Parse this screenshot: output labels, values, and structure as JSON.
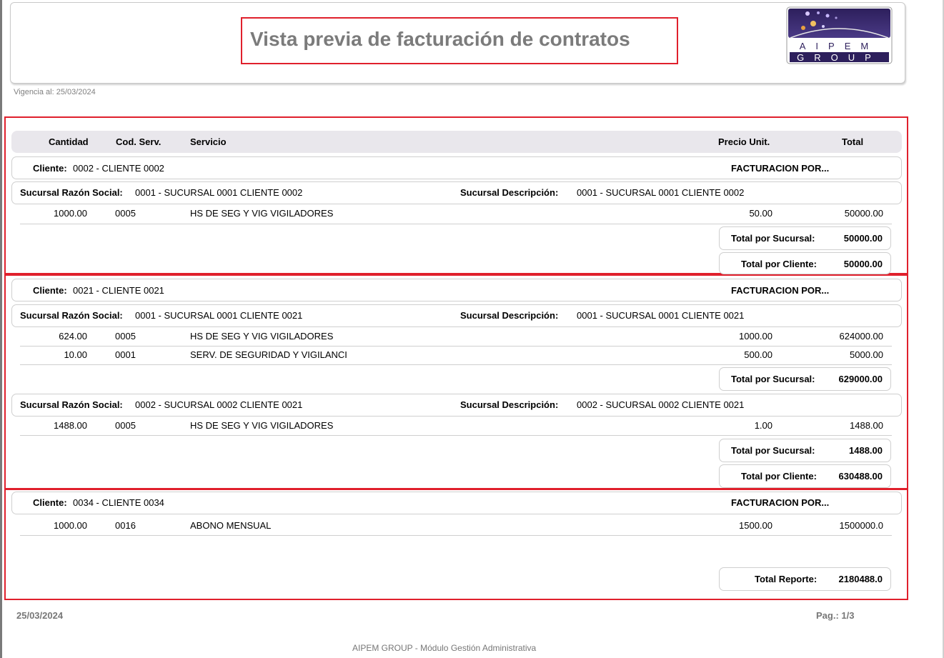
{
  "report": {
    "title": "Vista previa de facturación de contratos",
    "vigencia": "Vigencia al: 25/03/2024",
    "logo_top": "AIPEM",
    "logo_bottom": "GROUP"
  },
  "columns": {
    "cantidad": "Cantidad",
    "cod_serv": "Cod. Serv.",
    "servicio": "Servicio",
    "precio": "Precio Unit.",
    "total": "Total"
  },
  "labels": {
    "cliente": "Cliente:",
    "facturacion": "FACTURACION  POR...",
    "razon": "Sucursal Razón Social:",
    "descripcion": "Sucursal Descripción:",
    "total_sucursal": "Total por Sucursal:",
    "total_cliente": "Total por Cliente:",
    "total_reporte": "Total Reporte:"
  },
  "clients": [
    {
      "name": "0002 - CLIENTE 0002",
      "branches": [
        {
          "razon": "0001 - SUCURSAL 0001 CLIENTE 0002",
          "descripcion": "0001 - SUCURSAL 0001 CLIENTE 0002",
          "rows": [
            {
              "cantidad": "1000.00",
              "cod": "0005",
              "servicio": "HS DE SEG Y VIG VIGILADORES",
              "precio": "50.00",
              "total": "50000.00"
            }
          ],
          "total": "50000.00"
        }
      ],
      "total": "50000.00"
    },
    {
      "name": "0021 - CLIENTE 0021",
      "branches": [
        {
          "razon": "0001 - SUCURSAL 0001 CLIENTE 0021",
          "descripcion": "0001 - SUCURSAL 0001 CLIENTE 0021",
          "rows": [
            {
              "cantidad": "624.00",
              "cod": "0005",
              "servicio": "HS DE SEG Y VIG VIGILADORES",
              "precio": "1000.00",
              "total": "624000.00"
            },
            {
              "cantidad": "10.00",
              "cod": "0001",
              "servicio": "SERV. DE SEGURIDAD Y VIGILANCI",
              "precio": "500.00",
              "total": "5000.00"
            }
          ],
          "total": "629000.00"
        },
        {
          "razon": "0002 - SUCURSAL 0002 CLIENTE 0021",
          "descripcion": "0002 - SUCURSAL 0002 CLIENTE 0021",
          "rows": [
            {
              "cantidad": "1488.00",
              "cod": "0005",
              "servicio": "HS DE SEG Y VIG VIGILADORES",
              "precio": "1.00",
              "total": "1488.00"
            }
          ],
          "total": "1488.00"
        }
      ],
      "total": "630488.00"
    },
    {
      "name": "0034 - CLIENTE 0034",
      "rows": [
        {
          "cantidad": "1000.00",
          "cod": "0016",
          "servicio": "ABONO MENSUAL",
          "precio": "1500.00",
          "total": "1500000.0"
        }
      ]
    }
  ],
  "total_reporte": "2180488.0",
  "footer": {
    "date": "25/03/2024",
    "page": "Pag.: 1/3",
    "app": "AIPEM GROUP - Módulo Gestión Administrativa"
  }
}
